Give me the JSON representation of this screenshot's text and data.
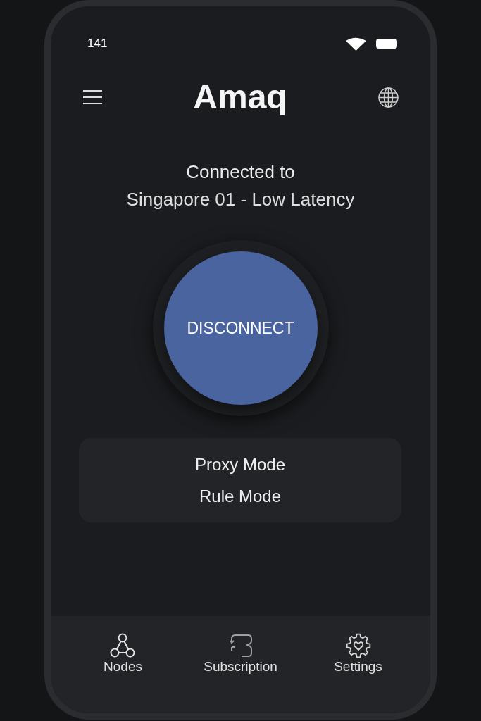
{
  "status_bar": {
    "time": "141"
  },
  "header": {
    "title": "Amaq"
  },
  "connection": {
    "status_line": "Connected to",
    "server": "Singapore 01 - Low Latency"
  },
  "main_button": {
    "label": "DISCONNECT"
  },
  "modes": [
    {
      "label": "Proxy Mode"
    },
    {
      "label": "Rule Mode"
    }
  ],
  "bottom_nav": [
    {
      "label": "Nodes"
    },
    {
      "label": "Subscription"
    },
    {
      "label": "Settings"
    }
  ]
}
